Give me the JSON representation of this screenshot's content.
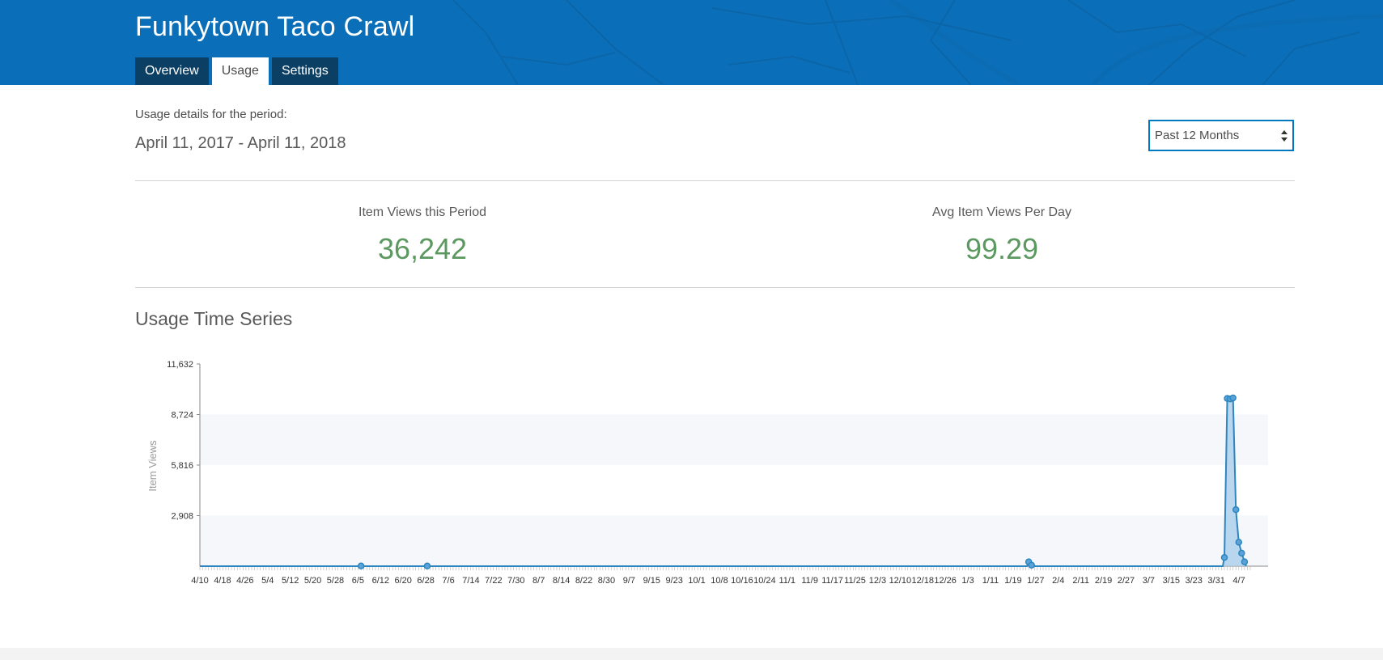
{
  "header": {
    "title": "Funkytown Taco Crawl",
    "tabs": [
      {
        "label": "Overview",
        "active": false
      },
      {
        "label": "Usage",
        "active": true
      },
      {
        "label": "Settings",
        "active": false
      }
    ]
  },
  "period": {
    "label": "Usage details for the period:",
    "range": "April 11, 2017 - April 11, 2018"
  },
  "period_select": {
    "selected": "Past 12 Months"
  },
  "stats": {
    "views_label": "Item Views this Period",
    "views_value": "36,242",
    "avg_label": "Avg Item Views Per Day",
    "avg_value": "99.29"
  },
  "section": {
    "title": "Usage Time Series"
  },
  "colors": {
    "banner": "#0a6fb8",
    "tab_dark": "#0b3f63",
    "stat_green": "#5c9960",
    "series": "#2e86c1",
    "area_fill": "#a9cdea"
  },
  "chart_data": {
    "type": "area",
    "title": "",
    "xlabel": "",
    "ylabel": "Item Views",
    "ylim": [
      0,
      11632
    ],
    "yticks": [
      2908,
      5816,
      8724,
      11632
    ],
    "ytick_labels": [
      "2,908",
      "5,816",
      "8,724",
      "11,632"
    ],
    "grid_bands": true,
    "legend": "none",
    "x_start": "4/10",
    "x_end": "4/10",
    "xtick_labels": [
      "4/10",
      "4/18",
      "4/26",
      "5/4",
      "5/12",
      "5/20",
      "5/28",
      "6/5",
      "6/12",
      "6/20",
      "6/28",
      "7/6",
      "7/14",
      "7/22",
      "7/30",
      "8/7",
      "8/14",
      "8/22",
      "8/30",
      "9/7",
      "9/15",
      "9/23",
      "10/1",
      "10/8",
      "10/16",
      "10/24",
      "11/1",
      "11/9",
      "11/17",
      "11/25",
      "12/3",
      "12/10",
      "12/18",
      "12/26",
      "1/3",
      "1/11",
      "1/19",
      "1/27",
      "2/4",
      "2/11",
      "2/19",
      "2/27",
      "3/7",
      "3/15",
      "3/23",
      "3/31",
      "4/7"
    ],
    "series": [
      {
        "baseline": 0,
        "points": [
          {
            "x": "6/5",
            "y": 10
          },
          {
            "x": "6/28",
            "y": 10
          },
          {
            "x": "1/23",
            "y": 250
          },
          {
            "x": "1/24",
            "y": 60
          },
          {
            "x": "4/1",
            "y": 500
          },
          {
            "x": "4/2",
            "y": 9650
          },
          {
            "x": "4/3",
            "y": 9620
          },
          {
            "x": "4/4",
            "y": 9680
          },
          {
            "x": "4/5",
            "y": 3250
          },
          {
            "x": "4/6",
            "y": 1380
          },
          {
            "x": "4/7",
            "y": 750
          },
          {
            "x": "4/8",
            "y": 250
          }
        ]
      }
    ]
  }
}
